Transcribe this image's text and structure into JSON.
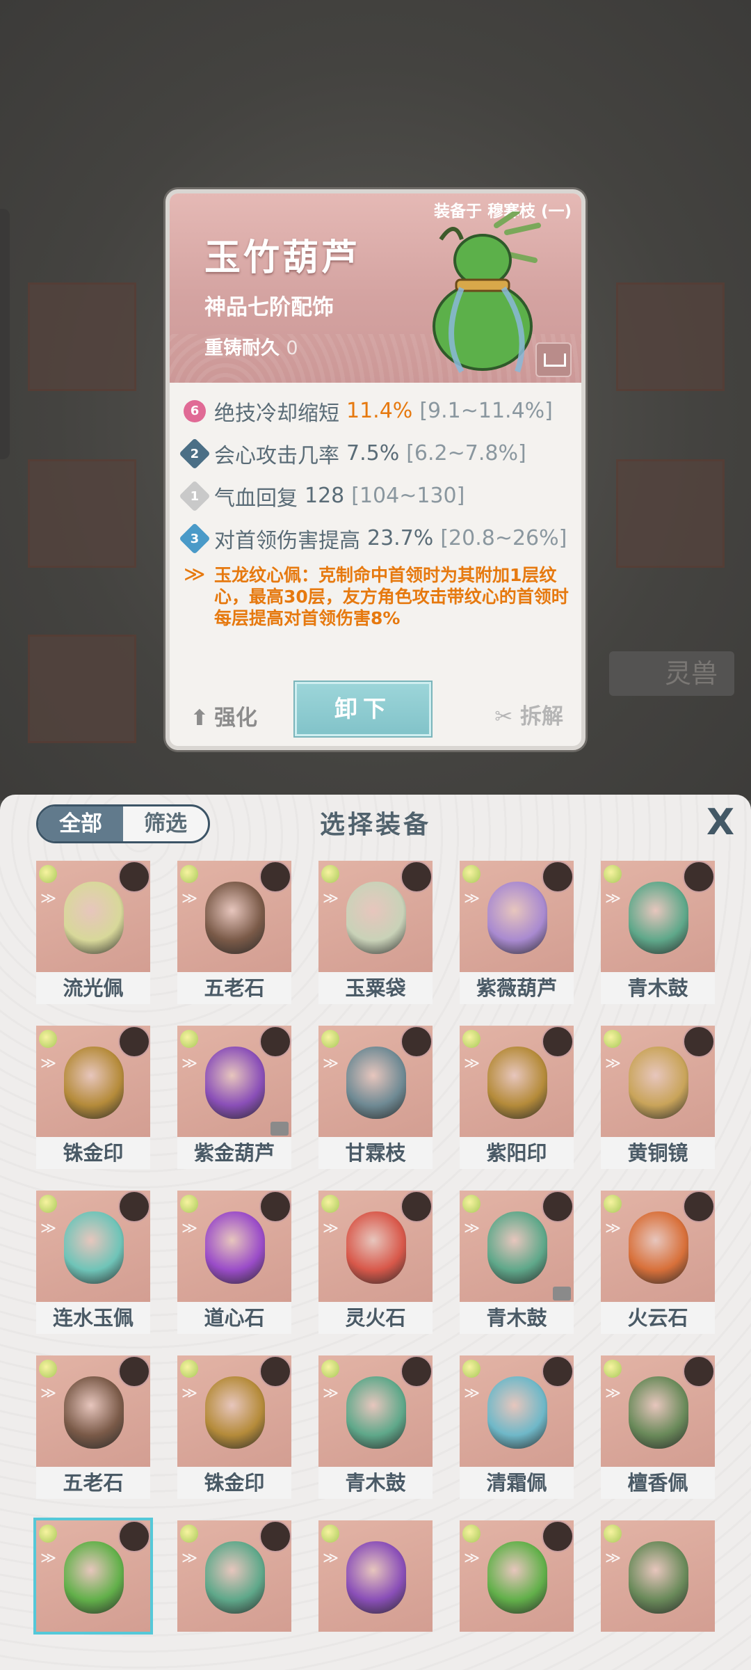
{
  "card": {
    "equipped_on": "装备于 穆寒枝 (一)",
    "name": "玉竹葫芦",
    "grade": "神品七阶配饰",
    "recast_label": "重铸耐久",
    "recast_value": "0",
    "stats": [
      {
        "badge": "6",
        "label": "绝技冷却缩短",
        "value": "11.4%",
        "range": "[9.1~11.4%]",
        "highlight": true
      },
      {
        "badge": "2",
        "label": "会心攻击几率",
        "value": "7.5%",
        "range": "[6.2~7.8%]",
        "highlight": false
      },
      {
        "badge": "1",
        "label": "气血回复",
        "value": "128",
        "range": "[104~130]",
        "highlight": false
      },
      {
        "badge": "3",
        "label": "对首领伤害提高",
        "value": "23.7%",
        "range": "[20.8~26%]",
        "highlight": false
      }
    ],
    "special_text": "玉龙纹心佩：克制命中首领时为其附加1层纹心，最高30层，友方角色攻击带纹心的首领时每层提高对首领伤害8%",
    "enhance_label": "强化",
    "unequip_label": "卸下",
    "dismantle_label": "拆解"
  },
  "background": {
    "tab_label": "灵兽"
  },
  "panel": {
    "filter_all": "全部",
    "filter_select": "筛选",
    "title": "选择装备",
    "close": "X",
    "items": [
      {
        "name": "流光佩",
        "color": "#d8d89a"
      },
      {
        "name": "五老石",
        "color": "#7a5a48"
      },
      {
        "name": "玉粟袋",
        "color": "#c9d2b8"
      },
      {
        "name": "紫薇葫芦",
        "color": "#a98ad0"
      },
      {
        "name": "青木鼓",
        "color": "#5fa88a"
      },
      {
        "name": "铢金印",
        "color": "#b58b3a"
      },
      {
        "name": "紫金葫芦",
        "color": "#8a4fb8"
      },
      {
        "name": "甘霖枝",
        "color": "#6f8a94"
      },
      {
        "name": "紫阳印",
        "color": "#b58b3a"
      },
      {
        "name": "黄铜镜",
        "color": "#c9a45a"
      },
      {
        "name": "连水玉佩",
        "color": "#6fc4b8"
      },
      {
        "name": "道心石",
        "color": "#9a4cc8"
      },
      {
        "name": "灵火石",
        "color": "#d8584a"
      },
      {
        "name": "青木鼓",
        "color": "#5fa88a"
      },
      {
        "name": "火云石",
        "color": "#d8703a"
      },
      {
        "name": "五老石",
        "color": "#7a5a48"
      },
      {
        "name": "铢金印",
        "color": "#b58b3a"
      },
      {
        "name": "青木鼓",
        "color": "#5fa88a"
      },
      {
        "name": "清霜佩",
        "color": "#6fb8c8"
      },
      {
        "name": "檀香佩",
        "color": "#6a8a5a"
      },
      {
        "name": "",
        "color": "#62b04a"
      },
      {
        "name": "",
        "color": "#5fa88a"
      },
      {
        "name": "",
        "color": "#8a4fb8"
      },
      {
        "name": "",
        "color": "#62b04a"
      },
      {
        "name": "",
        "color": "#6a8a5a"
      }
    ]
  }
}
